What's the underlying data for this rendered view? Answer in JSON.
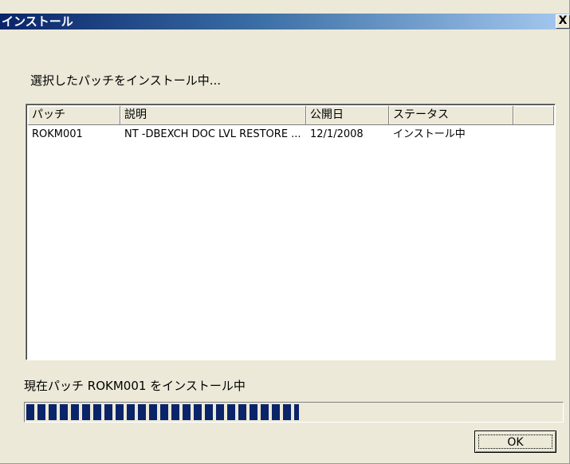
{
  "window": {
    "title": "インストール",
    "close_label": "X"
  },
  "heading": "選択したパッチをインストール中...",
  "list": {
    "columns": [
      "パッチ",
      "説明",
      "公開日",
      "ステータス",
      ""
    ],
    "rows": [
      [
        "ROKM001",
        "NT -DBEXCH DOC LVL RESTORE ...",
        "12/1/2008",
        "インストール中"
      ]
    ]
  },
  "status": "現在パッチ ROKM001 をインストール中",
  "progress": {
    "fraction": 0.51
  },
  "buttons": {
    "ok": "OK"
  },
  "colors": {
    "titlebar_start": "#0a246a",
    "progress_fill": "#0a246a",
    "face": "#ece9d8"
  }
}
